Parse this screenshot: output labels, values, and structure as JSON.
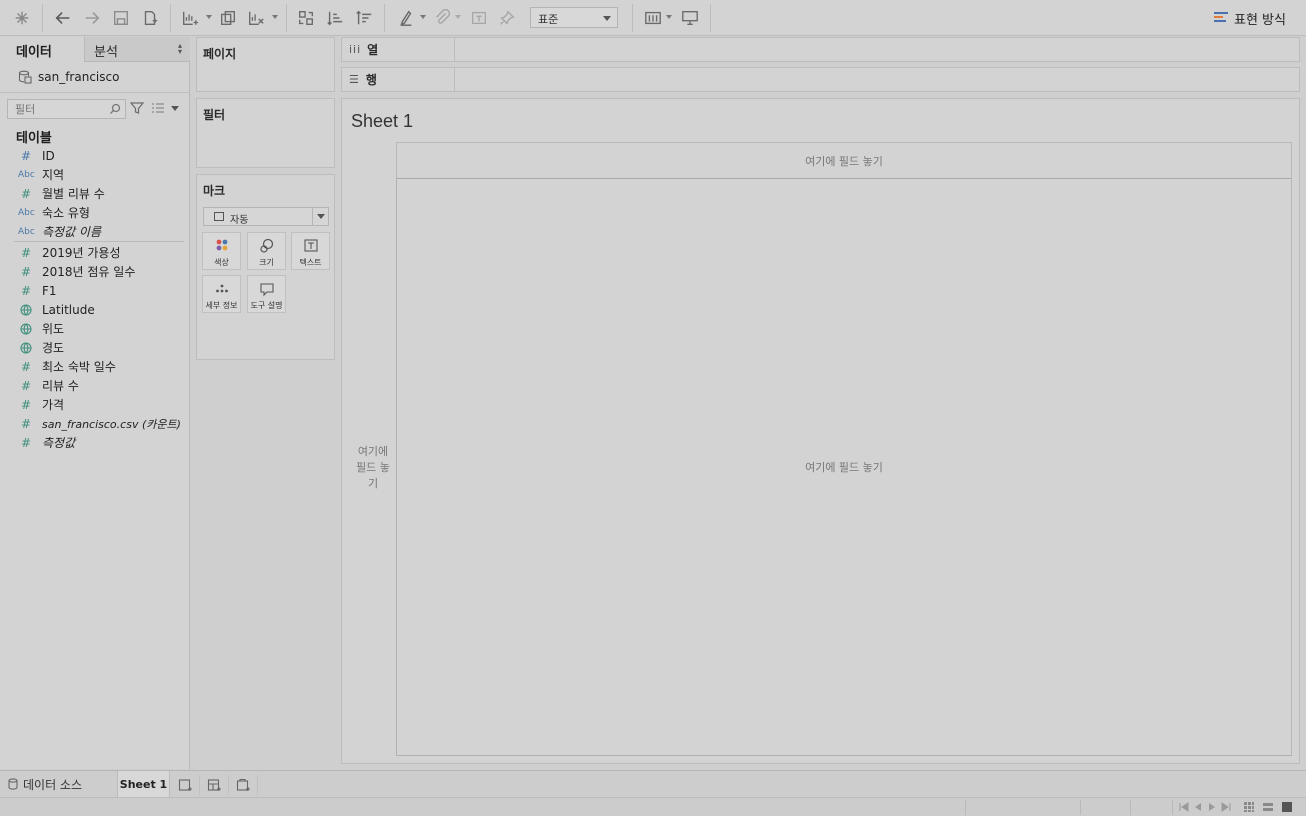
{
  "toolbar": {
    "fit_select": "표준",
    "show_me_label": "표현 방식"
  },
  "data_pane": {
    "tab_data": "데이터",
    "tab_analysis": "분석",
    "datasource_name": "san_francisco",
    "filter_placeholder": "필터",
    "tables_heading": "테이블",
    "fields": [
      {
        "icon": "hash",
        "name": "ID"
      },
      {
        "icon": "abc",
        "name": "지역"
      },
      {
        "icon": "hash",
        "name": "월별 리뷰 수"
      },
      {
        "icon": "abc",
        "name": "숙소 유형"
      },
      {
        "icon": "abc",
        "name": "측정값 이름"
      },
      {
        "icon": "hash",
        "name": "2019년 가용성"
      },
      {
        "icon": "hash",
        "name": "2018년 점유 일수"
      },
      {
        "icon": "hash",
        "name": "F1"
      },
      {
        "icon": "geo",
        "name": "Latitlude"
      },
      {
        "icon": "geo",
        "name": "위도"
      },
      {
        "icon": "geo",
        "name": "경도"
      },
      {
        "icon": "hash",
        "name": "최소 숙박 일수"
      },
      {
        "icon": "hash",
        "name": "리뷰 수"
      },
      {
        "icon": "hash",
        "name": "가격"
      },
      {
        "icon": "hash",
        "name": "san_francisco.csv (카운트)"
      },
      {
        "icon": "hash",
        "name": "측정값"
      }
    ]
  },
  "cards": {
    "pages_title": "페이지",
    "filters_title": "필터",
    "marks_title": "마크",
    "mark_type": "자동",
    "mark_buttons": {
      "color": "색상",
      "size": "크기",
      "text": "텍스트",
      "detail": "세부 정보",
      "tooltip": "도구 설명"
    }
  },
  "shelves": {
    "columns_label": "열",
    "rows_label": "행"
  },
  "view": {
    "sheet_title": "Sheet 1",
    "drop_columns": "여기에 필드 놓기",
    "drop_rows": "여기에 필드 놓기",
    "drop_main": "여기에 필드 놓기"
  },
  "bottom_tabs": {
    "datasource": "데이터 소스",
    "sheet": "Sheet 1"
  },
  "colors": {
    "measure_green": "#3f8f7c",
    "dimension_blue": "#4c78a8",
    "background_gray": "#cfcfcf"
  }
}
